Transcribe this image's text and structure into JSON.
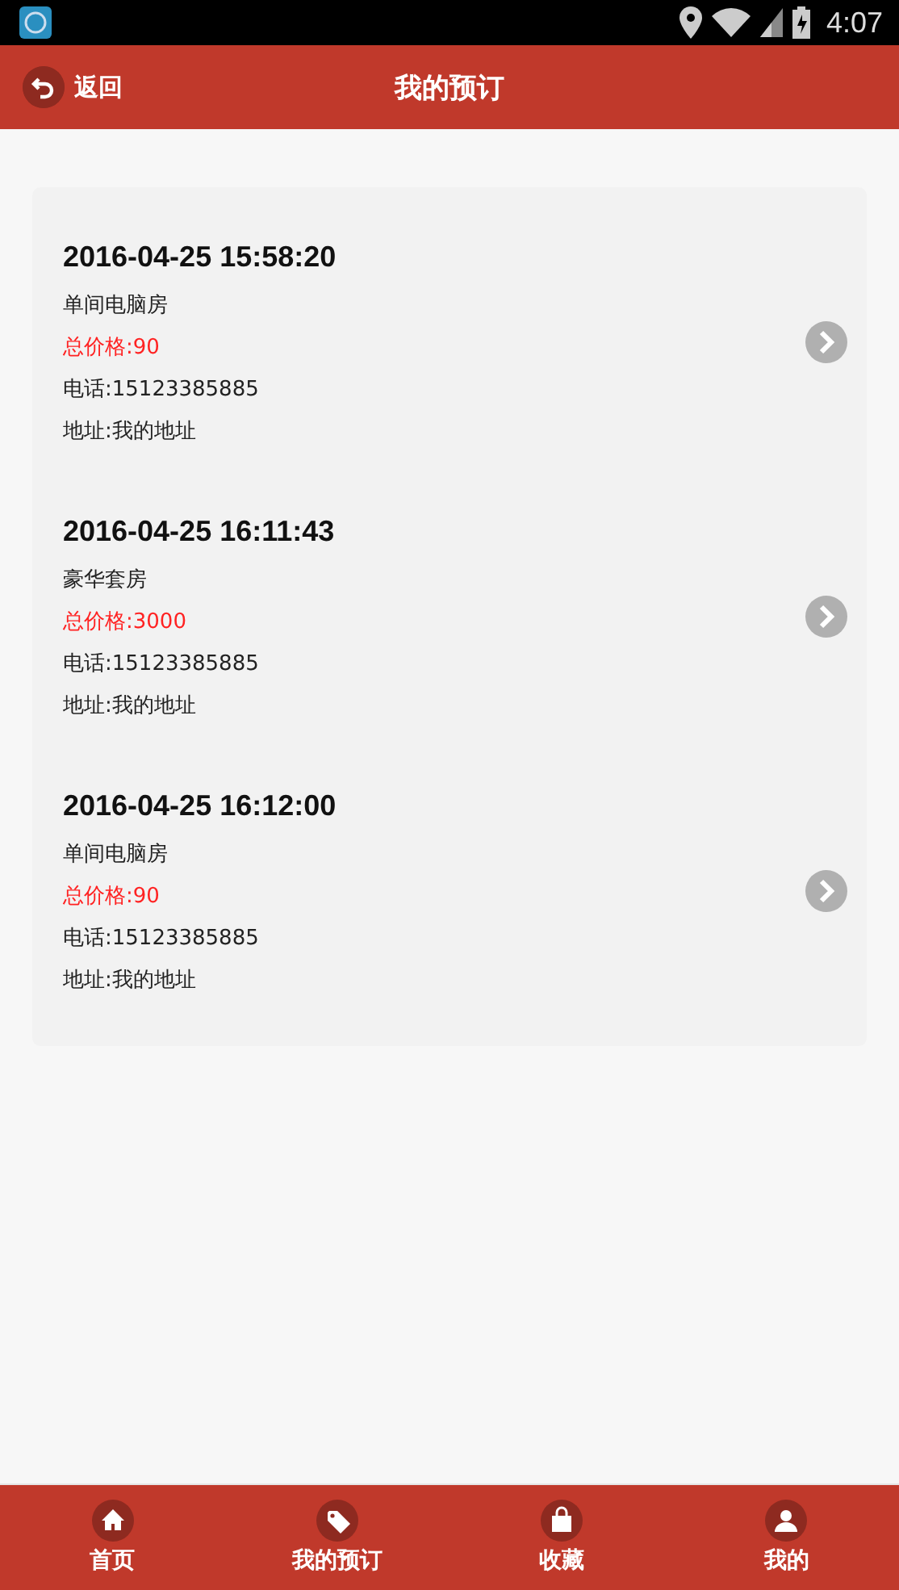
{
  "status_bar": {
    "time": "4:07"
  },
  "header": {
    "back": "返回",
    "title": "我的预订"
  },
  "orders": [
    {
      "time": "2016-04-25 15:58:20",
      "room": "单间电脑房",
      "price": "总价格:90",
      "phone": "电话:15123385885",
      "address": "地址:我的地址"
    },
    {
      "time": "2016-04-25 16:11:43",
      "room": "豪华套房",
      "price": "总价格:3000",
      "phone": "电话:15123385885",
      "address": "地址:我的地址"
    },
    {
      "time": "2016-04-25 16:12:00",
      "room": "单间电脑房",
      "price": "总价格:90",
      "phone": "电话:15123385885",
      "address": "地址:我的地址"
    }
  ],
  "tabs": [
    {
      "kind": "home",
      "label": "首页"
    },
    {
      "kind": "tag",
      "label": "我的预订"
    },
    {
      "kind": "bag",
      "label": "收藏"
    },
    {
      "kind": "user",
      "label": "我的"
    }
  ]
}
